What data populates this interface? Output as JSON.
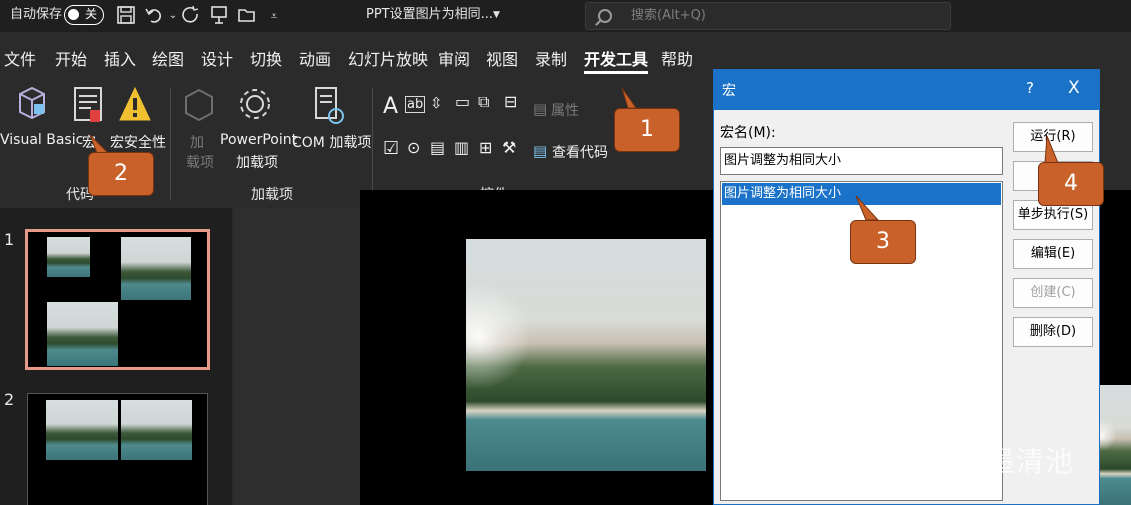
{
  "titlebar": {
    "autosave_label": "自动保存",
    "autosave_state": "关",
    "doc_title": "PPT设置图片为相同...",
    "search_placeholder": "搜索(Alt+Q)"
  },
  "tabs": [
    "文件",
    "开始",
    "插入",
    "绘图",
    "设计",
    "切换",
    "动画",
    "幻灯片放映",
    "审阅",
    "视图",
    "录制",
    "开发工具",
    "帮助"
  ],
  "active_tab": "开发工具",
  "ribbon": {
    "code": {
      "visual_basic": "Visual Basic",
      "macro": "宏",
      "macro_security": "宏安全性",
      "group": "代码"
    },
    "addins": {
      "addin_line1": "加",
      "addin_line2": "载项",
      "ppt_addin_line1": "PowerPoint",
      "ppt_addin_line2": "加载项",
      "com_addin": "COM 加载项",
      "group": "加载项"
    },
    "controls": {
      "properties": "属性",
      "view_code": "查看代码",
      "group": "控件"
    }
  },
  "slides": [
    {
      "number": "1"
    },
    {
      "number": "2"
    }
  ],
  "dialog": {
    "title": "宏",
    "help": "?",
    "close": "X",
    "name_label": "宏名(M):",
    "name_value": "图片调整为相同大小",
    "list_items": [
      "图片调整为相同大小"
    ],
    "buttons": {
      "run": "运行(R)",
      "step": "单步执行(S)",
      "edit": "编辑(E)",
      "create": "创建(C)",
      "delete": "删除(D)"
    }
  },
  "callouts": [
    "1",
    "2",
    "3",
    "4"
  ],
  "watermark": "知乎 @墨清池",
  "colors": {
    "accent": "#1a73c8",
    "callout": "#c8622a",
    "selected_slide_border": "#e59a8a",
    "ribbon_bg": "#2b2b2b"
  }
}
